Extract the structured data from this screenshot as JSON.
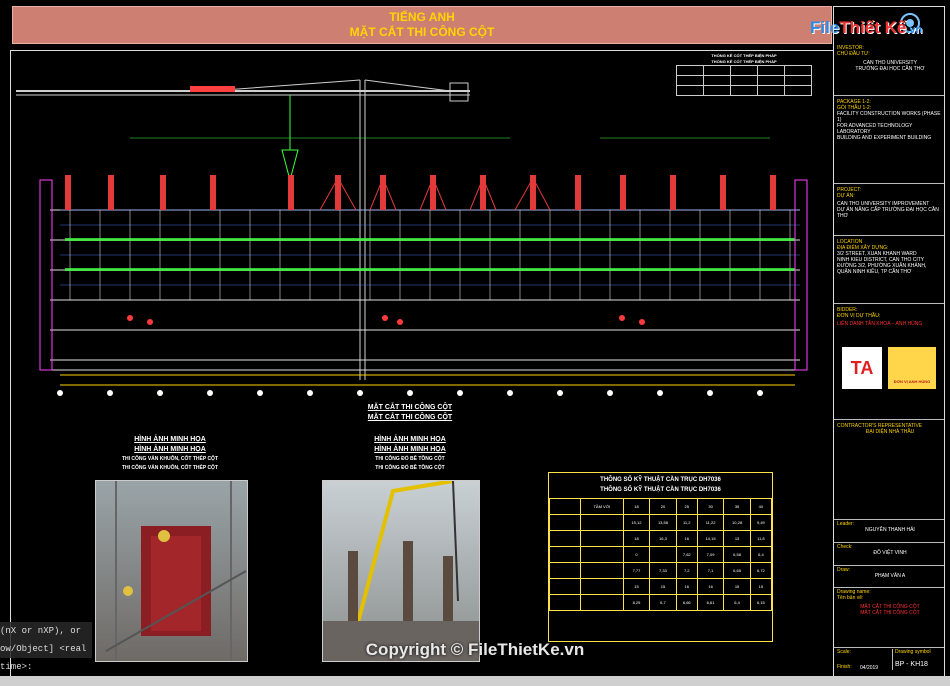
{
  "title_banner": {
    "line1": "TIẾNG ANH",
    "line2": "MẶT CẮT THI CÔNG CỘT"
  },
  "logo": {
    "text_1": "File",
    "text_2": "Thiết Kế",
    "text_3": ".vn"
  },
  "crane_table": {
    "heading_1": "THỐNG KÊ CỐT THÉP BIỆN PHÁP",
    "heading_2": "THỐNG KÊ CỐT THÉP BIỆN PHÁP"
  },
  "section": {
    "title_1": "MẶT CẮT THI CÔNG CỘT",
    "title_2": "MẶT CẮT THI CÔNG CỘT",
    "photo_caption_1": "HÌNH ẢNH MINH HỌA",
    "photo_caption_2": "HÌNH ẢNH MINH HỌA",
    "photo1_sub_1": "THI CÔNG VÁN KHUÔN, CỐT THÉP CỘT",
    "photo1_sub_2": "THI CÔNG VÁN KHUÔN, CỐT THÉP CỘT",
    "photo2_sub_1": "THI CÔNG ĐỔ BÊ TÔNG CỘT",
    "photo2_sub_2": "THI CÔNG ĐỔ BÊ TÔNG CỘT"
  },
  "spec_table": {
    "title_1": "THÔNG SỐ KỸ THUẬT CẦN TRỤC DH7036",
    "title_2": "THÔNG SỐ KỸ THUẬT CẦN TRỤC DH7036",
    "header": [
      "TẦM VỚI",
      "18",
      "20",
      "25",
      "30",
      "35",
      "40"
    ],
    "rows": [
      [
        "",
        "15,12",
        "13,58",
        "11,2",
        "11,22",
        "10,28",
        "9,49"
      ],
      [
        "",
        "18",
        "16,3",
        "16",
        "14,15",
        "13",
        "11,8"
      ],
      [
        "",
        "0",
        "",
        "7,62",
        "7,09",
        "6,58",
        "6,4"
      ],
      [
        "",
        "7,77",
        "7,33",
        "7,2",
        "7,1",
        "6,65",
        "6,72"
      ],
      [
        "",
        "15",
        "15",
        "16",
        "16",
        "15",
        "15"
      ],
      [
        "",
        "8,25",
        "6,7",
        "6,66",
        "6,61",
        "6,4",
        "6,15"
      ]
    ]
  },
  "titleblock": {
    "investor_label": "INVESTOR:",
    "investor_label_vn": "CHỦ ĐẦU TƯ:",
    "investor_1": "CAN THO UNIVERSITY",
    "investor_2": "TRƯỜNG ĐẠI HỌC CẦN THƠ",
    "package_label": "PACKAGE 1-2:",
    "package_label_vn": "GÓI THẦU 1-2:",
    "package_1": "FACILITY CONSTRUCTION WORKS (PHASE 1)",
    "package_2": "FOR ADVANCED TECHNOLOGY LABORATORY",
    "package_3": "BUILDING AND EXPERIMENT BUILDING",
    "project_label": "PROJECT:",
    "project_label_vn": "DỰ ÁN:",
    "project_1": "CAN THO UNIVERSITY IMPROVEMENT",
    "project_2": "DỰ ÁN NÂNG CẤP TRƯỜNG ĐẠI HỌC CẦN THƠ",
    "location_label": "LOCATION",
    "location_label_vn": "ĐỊA ĐIỂM XÂY DỰNG:",
    "location_1": "3/2 STREET, XUAN KHANH WARD",
    "location_2": "NINH KIEU DISTRICT, CAN THO CITY",
    "location_3": "ĐƯỜNG 3/2, PHƯỜNG XUÂN KHÁNH,",
    "location_4": "QUẬN NINH KIỀU, TP CẦN THƠ",
    "bidder_label": "BIDDER:",
    "bidder_label_vn": "ĐƠN VỊ DỰ THẦU:",
    "bidder_name": "LIÊN DANH TÂN KHOA – ANH HÙNG",
    "logo_left": "TA",
    "logo_right": "ĐƠN VỊ ANH HÙNG",
    "contractor_label": "CONTRACTOR'S REPRESENTATIVE",
    "contractor_label_vn": "ĐẠI DIỆN NHÀ THẦU",
    "leader_label": "Leader:",
    "leader_name": "NGUYỄN THANH HẢI",
    "check_label": "Check:",
    "check_name": "ĐỖ VIỆT VINH",
    "draw_label": "Draw:",
    "draw_name": "PHẠM VĂN A",
    "drawing_name_label": "Drawing name:",
    "drawing_name_label_vn": "Tên bản vẽ:",
    "drawing_name_1": "MẶT CẮT THI CÔNG CỘT",
    "drawing_name_2": "MẶT CẮT THI CÔNG CỘT",
    "scale_label": "Scale:",
    "symbol_label": "Drawing symbol",
    "symbol_value": "BP - KH18",
    "finish_label": "Finish:",
    "finish_value": "04/2019"
  },
  "command_line": {
    "line1": "(nX or nXP), or",
    "line2": "ow/Object] <real time>:"
  },
  "watermark": "Copyright © FileThietKe.vn"
}
